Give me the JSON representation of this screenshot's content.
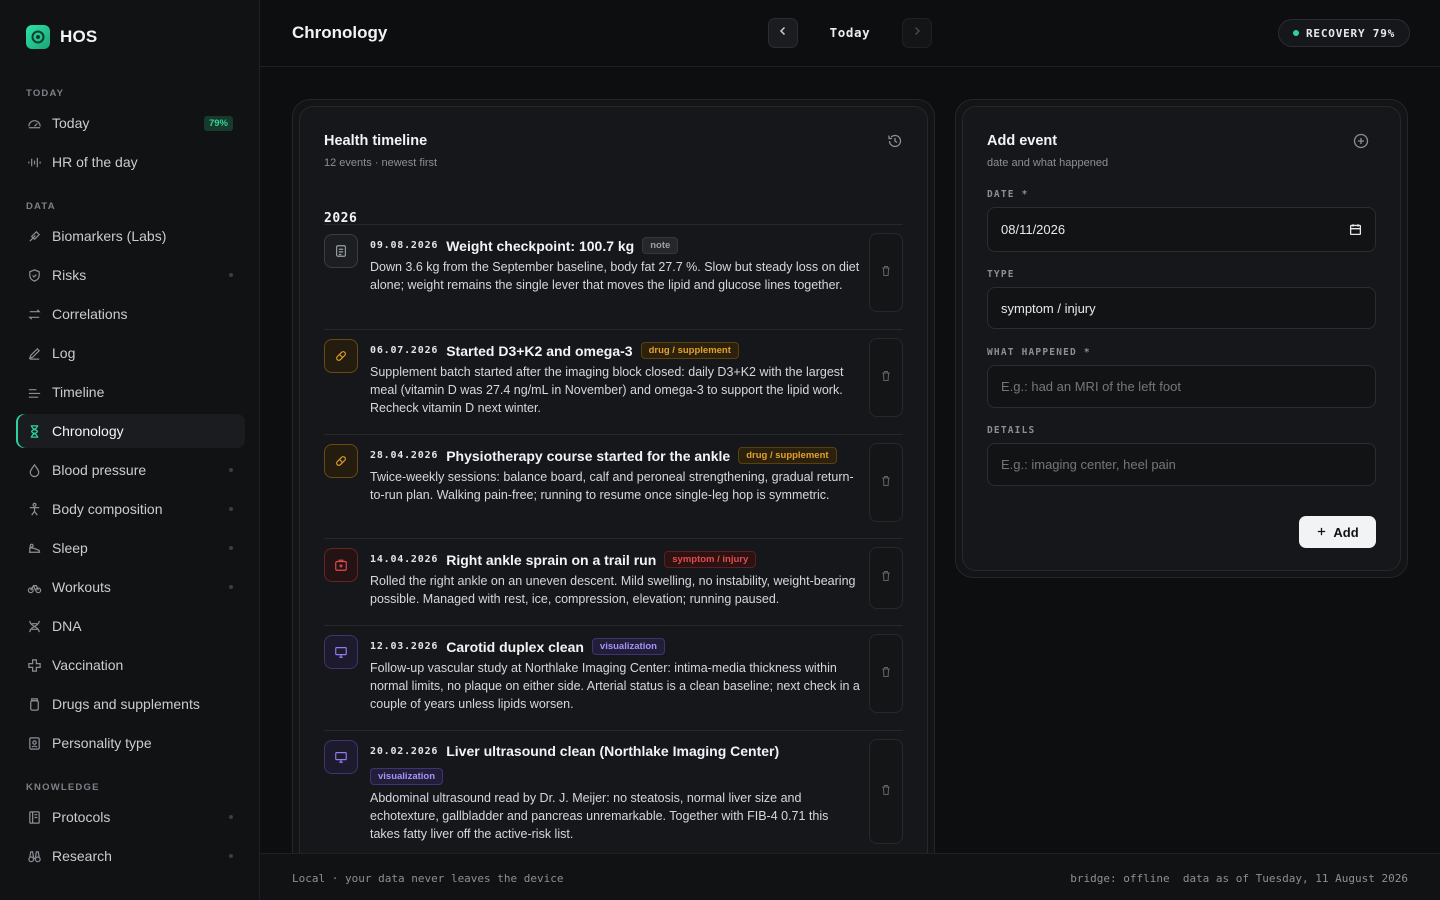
{
  "app": {
    "name": "HOS",
    "page_title": "Chronology"
  },
  "sidebar": {
    "sections": {
      "today": "TODAY",
      "data": "DATA",
      "knowledge": "KNOWLEDGE"
    },
    "items": [
      {
        "label": "Today",
        "icon": "gauge-icon",
        "badge": "79%"
      },
      {
        "label": "HR of the day",
        "icon": "waveform-icon"
      },
      {
        "label": "Biomarkers (Labs)",
        "icon": "pipette-icon"
      },
      {
        "label": "Risks",
        "icon": "shield-icon"
      },
      {
        "label": "Correlations",
        "icon": "arrows-swap-icon"
      },
      {
        "label": "Log",
        "icon": "pencil-icon"
      },
      {
        "label": "Timeline",
        "icon": "timeline-icon"
      },
      {
        "label": "Chronology",
        "icon": "hourglass-icon"
      },
      {
        "label": "Blood pressure",
        "icon": "droplet-icon"
      },
      {
        "label": "Body composition",
        "icon": "body-icon"
      },
      {
        "label": "Sleep",
        "icon": "bed-icon"
      },
      {
        "label": "Workouts",
        "icon": "bike-icon"
      },
      {
        "label": "DNA",
        "icon": "dna-icon"
      },
      {
        "label": "Vaccination",
        "icon": "plus-cross-icon"
      },
      {
        "label": "Drugs and supplements",
        "icon": "pill-bottle-icon"
      },
      {
        "label": "Personality type",
        "icon": "id-card-icon"
      },
      {
        "label": "Protocols",
        "icon": "book-icon"
      },
      {
        "label": "Research",
        "icon": "binoculars-icon"
      }
    ]
  },
  "topbar": {
    "date_label": "Today",
    "recovery": "RECOVERY 79%"
  },
  "timeline": {
    "title": "Health timeline",
    "subtitle": "12 events · newest first",
    "year": "2026",
    "events": [
      {
        "date": "09.08.2026",
        "title": "Weight checkpoint: 100.7 kg",
        "type": "note",
        "text": "Down 3.6 kg from the September baseline, body fat 27.7 %. Slow but steady loss on diet alone; weight remains the single lever that moves the lipid and glucose lines together."
      },
      {
        "date": "06.07.2026",
        "title": "Started D3+K2 and omega-3",
        "type": "drug / supplement",
        "text": "Supplement batch started after the imaging block closed: daily D3+K2 with the largest meal (vitamin D was 27.4 ng/mL in November) and omega-3 to support the lipid work. Recheck vitamin D next winter."
      },
      {
        "date": "28.04.2026",
        "title": "Physiotherapy course started for the ankle",
        "type": "drug / supplement",
        "text": "Twice-weekly sessions: balance board, calf and peroneal strengthening, gradual return-to-run plan. Walking pain-free; running to resume once single-leg hop is symmetric."
      },
      {
        "date": "14.04.2026",
        "title": "Right ankle sprain on a trail run",
        "type": "symptom / injury",
        "text": "Rolled the right ankle on an uneven descent. Mild swelling, no instability, weight-bearing possible. Managed with rest, ice, compression, elevation; running paused."
      },
      {
        "date": "12.03.2026",
        "title": "Carotid duplex clean",
        "type": "visualization",
        "text": "Follow-up vascular study at Northlake Imaging Center: intima-media thickness within normal limits, no plaque on either side. Arterial status is a clean baseline; next check in a couple of years unless lipids worsen."
      },
      {
        "date": "20.02.2026",
        "title": "Liver ultrasound clean (Northlake Imaging Center)",
        "type": "visualization",
        "text": "Abdominal ultrasound read by Dr. J. Meijer: no steatosis, normal liver size and echotexture, gallbladder and pancreas unremarkable. Together with FIB-4 0.71 this takes fatty liver off the active-risk list."
      }
    ]
  },
  "form": {
    "title": "Add event",
    "subtitle": "date and what happened",
    "date_label": "DATE *",
    "date_value": "08/11/2026",
    "type_label": "TYPE",
    "type_value": "symptom / injury",
    "what_label": "WHAT HAPPENED *",
    "what_placeholder": "E.g.: had an MRI of the left foot",
    "details_label": "DETAILS",
    "details_placeholder": "E.g.: imaging center, heel pain",
    "add_label": "Add"
  },
  "footer": {
    "left": "Local · your data never leaves the device",
    "right": "bridge: offline  data as of Tuesday, 11 August 2026"
  },
  "colors": {
    "accent": "#2fd39a",
    "drug": "#e2a12f",
    "symptom": "#e24b4b",
    "visualization": "#a295f5"
  }
}
